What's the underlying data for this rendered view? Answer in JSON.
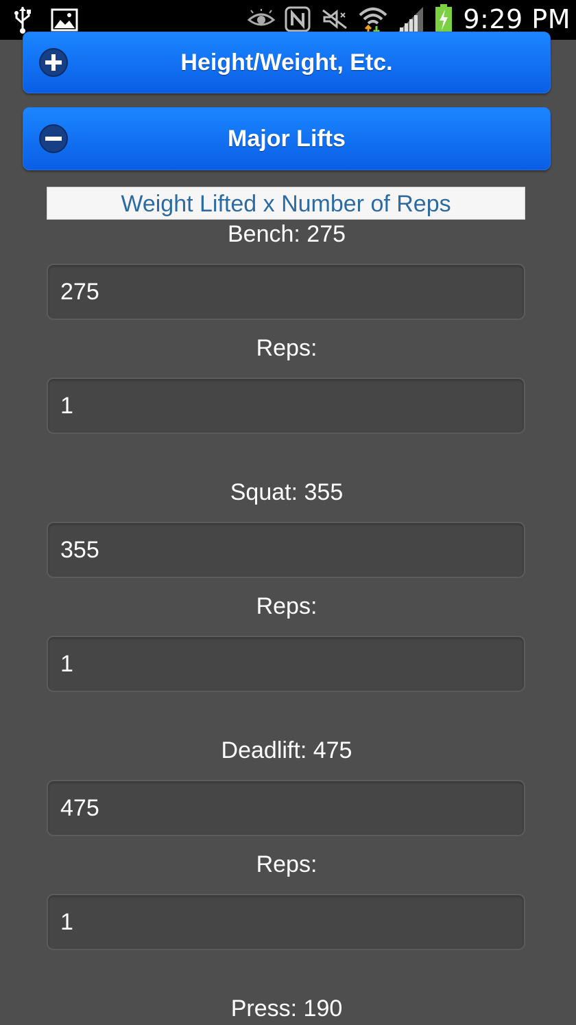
{
  "status_bar": {
    "time": "9:29 PM",
    "icons": [
      "usb-icon",
      "image-icon",
      "eye-icon",
      "nfc-icon",
      "mute-icon",
      "wifi-icon",
      "signal-icon",
      "battery-charging-icon"
    ]
  },
  "sections": {
    "height_weight": {
      "title": "Height/Weight, Etc.",
      "state": "collapsed"
    },
    "major_lifts": {
      "title": "Major Lifts",
      "state": "expanded"
    }
  },
  "lifts": {
    "header": "Weight Lifted x Number of Reps",
    "reps_label": "Reps:",
    "bench": {
      "label": "Bench: 275",
      "weight": "275",
      "reps": "1"
    },
    "squat": {
      "label": "Squat: 355",
      "weight": "355",
      "reps": "1"
    },
    "deadlift": {
      "label": "Deadlift: 475",
      "weight": "475",
      "reps": "1"
    },
    "press": {
      "label": "Press: 190"
    }
  },
  "colors": {
    "accent": "#0a6cf5",
    "background": "#4e4e4e",
    "header_text": "#2c6aa0"
  }
}
